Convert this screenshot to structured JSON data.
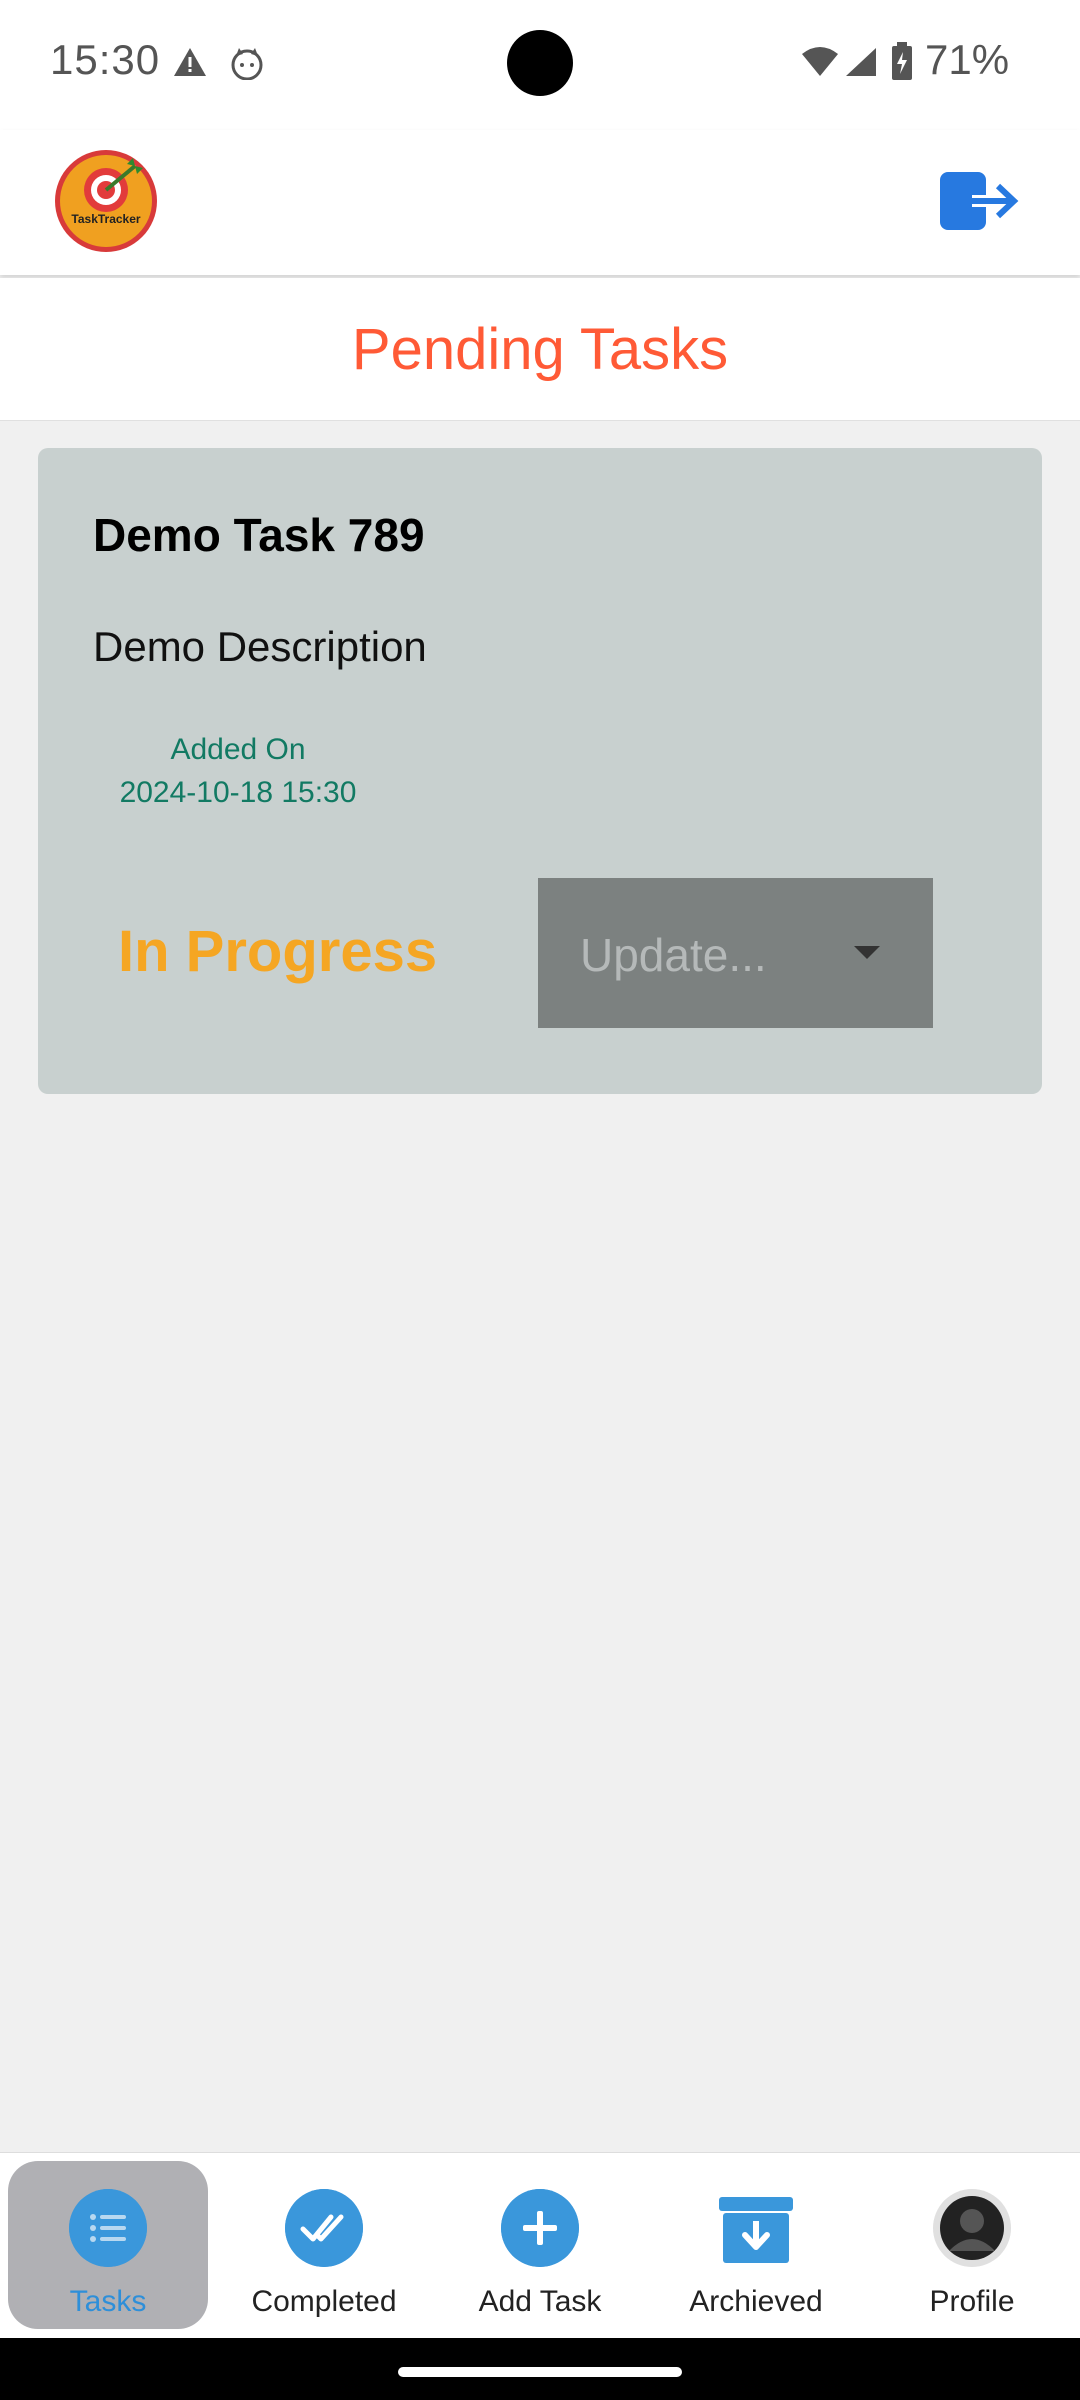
{
  "status_bar": {
    "time": "15:30",
    "battery": "71%",
    "icons": [
      "alert-icon",
      "cat-icon",
      "wifi-icon",
      "signal-icon",
      "battery-icon"
    ]
  },
  "app_bar": {
    "logo_text": "TaskTracker",
    "logout_icon": "logout-icon"
  },
  "header": {
    "title": "Pending Tasks"
  },
  "task": {
    "title": "Demo Task 789",
    "description": "Demo Description",
    "added_label": "Added On",
    "added_date": "2024-10-18 15:30",
    "status": "In Progress",
    "update_placeholder": "Update..."
  },
  "bottom_nav": {
    "items": [
      {
        "label": "Tasks",
        "icon": "list-icon"
      },
      {
        "label": "Completed",
        "icon": "double-check-icon"
      },
      {
        "label": "Add Task",
        "icon": "plus-icon"
      },
      {
        "label": "Archieved",
        "icon": "archive-icon"
      },
      {
        "label": "Profile",
        "icon": "user-icon"
      }
    ]
  },
  "colors": {
    "accent": "#ff5a36",
    "nav_blue": "#3a97db",
    "status_orange": "#f5a623",
    "date_green": "#127a63",
    "card_bg": "#c8d0cf"
  }
}
